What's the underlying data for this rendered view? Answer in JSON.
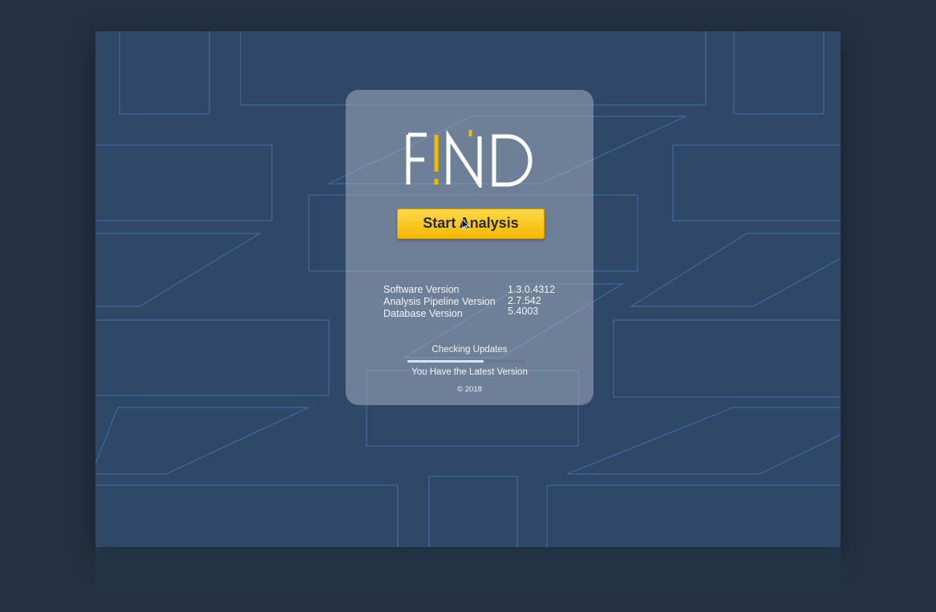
{
  "app": {
    "logo_text": "F!ND",
    "accent_color": "#f5b800"
  },
  "actions": {
    "start_label": "Start Analysis"
  },
  "versions": [
    {
      "label": "Software Version",
      "value": "1.3.0.4312"
    },
    {
      "label": "Analysis Pipeline Version",
      "value": "2.7.542"
    },
    {
      "label": "Database Version",
      "value": "5.4003"
    }
  ],
  "update": {
    "status": "Checking Updates",
    "progress": 0.65,
    "result": "You Have the Latest Version"
  },
  "footer": {
    "copyright": "© 2018"
  },
  "colors": {
    "background": "#233142",
    "window": "#2f4868",
    "button": "#ffd84a"
  }
}
